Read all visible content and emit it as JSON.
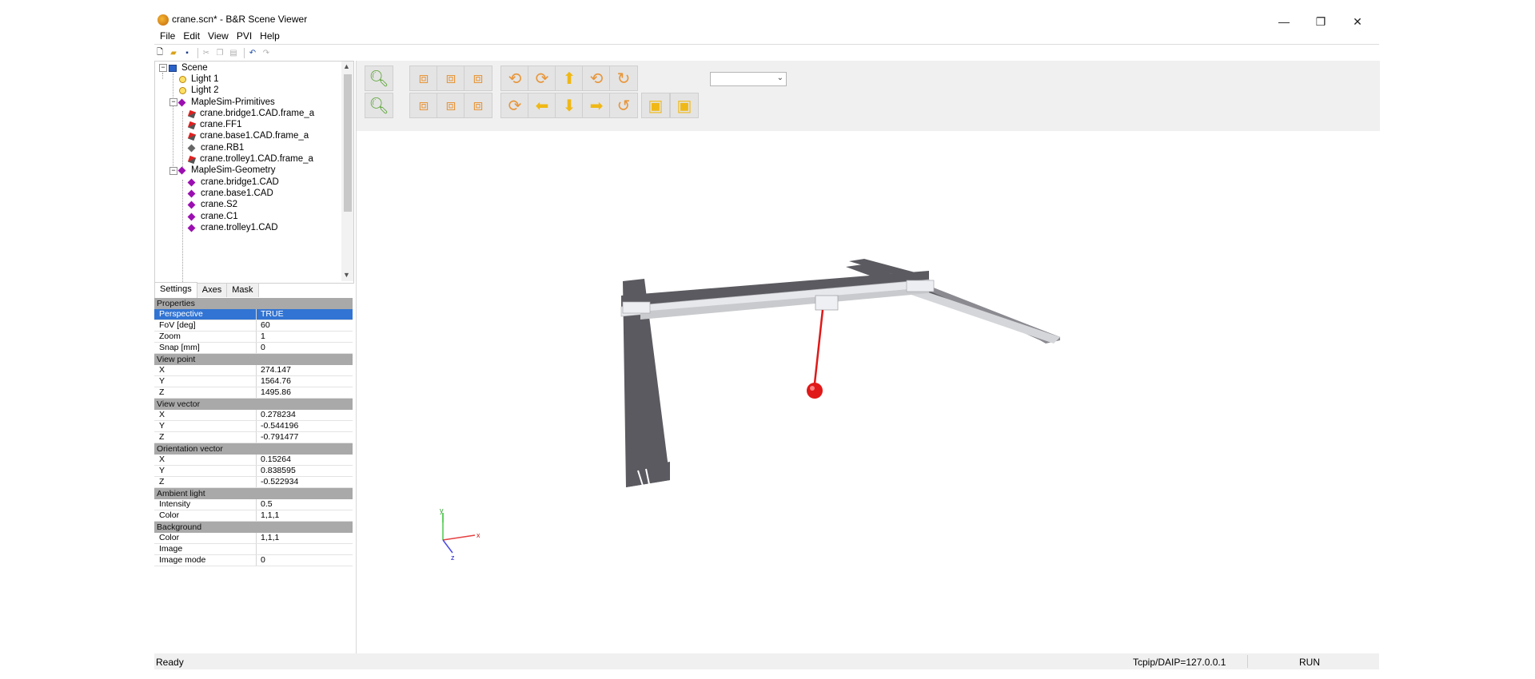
{
  "window": {
    "title": "crane.scn* - B&R Scene Viewer",
    "minimize": "—",
    "maximize": "❐",
    "close": "✕"
  },
  "menu": [
    "File",
    "Edit",
    "View",
    "PVI",
    "Help"
  ],
  "tree": {
    "root": "Scene",
    "items": [
      {
        "label": "Light 1",
        "icon": "light-icon"
      },
      {
        "label": "Light 2",
        "icon": "light-icon"
      },
      {
        "label": "MapleSim-Primitives",
        "icon": "group-icon"
      },
      {
        "label": "crane.bridge1.CAD.frame_a",
        "icon": "frame-icon"
      },
      {
        "label": "crane.FF1",
        "icon": "frame-icon"
      },
      {
        "label": "crane.base1.CAD.frame_a",
        "icon": "frame-icon"
      },
      {
        "label": "crane.RB1",
        "icon": "body-icon"
      },
      {
        "label": "crane.trolley1.CAD.frame_a",
        "icon": "frame-icon"
      },
      {
        "label": "MapleSim-Geometry",
        "icon": "group-icon"
      },
      {
        "label": "crane.bridge1.CAD",
        "icon": "geometry-icon"
      },
      {
        "label": "crane.base1.CAD",
        "icon": "geometry-icon"
      },
      {
        "label": "crane.S2",
        "icon": "geometry-icon"
      },
      {
        "label": "crane.C1",
        "icon": "geometry-icon"
      },
      {
        "label": "crane.trolley1.CAD",
        "icon": "geometry-icon"
      }
    ]
  },
  "tabs": [
    "Settings",
    "Axes",
    "Mask"
  ],
  "properties": {
    "groups": [
      {
        "title": "Properties",
        "rows": [
          {
            "key": "Perspective",
            "value": "TRUE"
          },
          {
            "key": "FoV [deg]",
            "value": "60"
          },
          {
            "key": "Zoom",
            "value": "1"
          },
          {
            "key": "Snap [mm]",
            "value": "0"
          }
        ]
      },
      {
        "title": "View point",
        "rows": [
          {
            "key": "X",
            "value": "274.147"
          },
          {
            "key": "Y",
            "value": "1564.76"
          },
          {
            "key": "Z",
            "value": "1495.86"
          }
        ]
      },
      {
        "title": "View vector",
        "rows": [
          {
            "key": "X",
            "value": "0.278234"
          },
          {
            "key": "Y",
            "value": "-0.544196"
          },
          {
            "key": "Z",
            "value": "-0.791477"
          }
        ]
      },
      {
        "title": "Orientation vector",
        "rows": [
          {
            "key": "X",
            "value": "0.15264"
          },
          {
            "key": "Y",
            "value": "0.838595"
          },
          {
            "key": "Z",
            "value": "-0.522934"
          }
        ]
      },
      {
        "title": "Ambient light",
        "rows": [
          {
            "key": "Intensity",
            "value": "0.5"
          },
          {
            "key": "Color",
            "value": "1,1,1"
          }
        ]
      },
      {
        "title": "Background",
        "rows": [
          {
            "key": "Color",
            "value": "1,1,1"
          },
          {
            "key": "Image",
            "value": ""
          },
          {
            "key": "Image mode",
            "value": "0"
          }
        ]
      }
    ]
  },
  "axes": {
    "x": "x",
    "y": "y",
    "z": "z"
  },
  "status": {
    "text": "Ready",
    "connection": "Tcpip/DAIP=127.0.0.1",
    "mode": "RUN"
  }
}
